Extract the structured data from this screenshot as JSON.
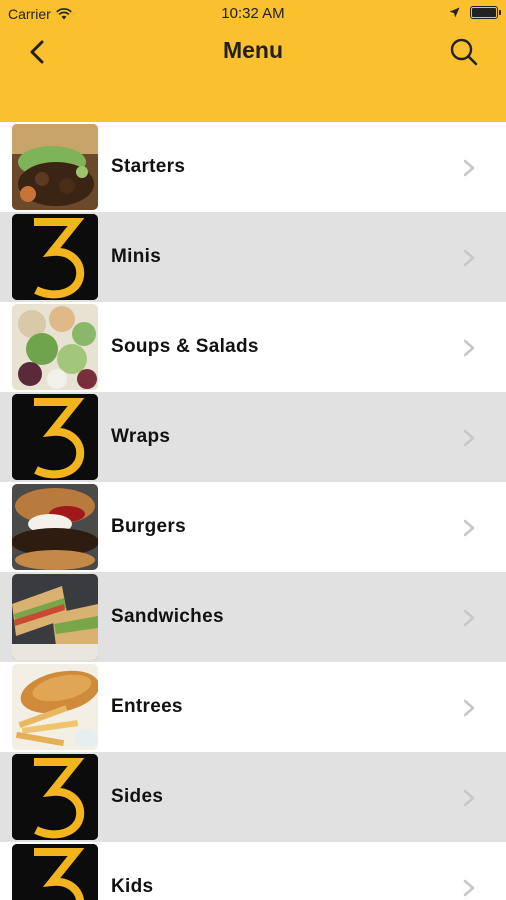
{
  "status_bar": {
    "carrier": "Carrier",
    "time": "10:32 AM"
  },
  "nav": {
    "title": "Menu",
    "back_icon": "chevron-left-icon",
    "search_icon": "search-icon"
  },
  "colors": {
    "header": "#FBC02D",
    "alt_row": "#E1E1E1",
    "logo_yellow": "#F2B51E",
    "chevron": "#C7C7C7"
  },
  "menu_items": [
    {
      "label": "Starters",
      "thumb": "photo"
    },
    {
      "label": "Minis",
      "thumb": "logo-3"
    },
    {
      "label": "Soups & Salads",
      "thumb": "photo"
    },
    {
      "label": "Wraps",
      "thumb": "logo-3"
    },
    {
      "label": "Burgers",
      "thumb": "photo"
    },
    {
      "label": "Sandwiches",
      "thumb": "photo"
    },
    {
      "label": "Entrees",
      "thumb": "photo"
    },
    {
      "label": "Sides",
      "thumb": "logo-3"
    },
    {
      "label": "Kids",
      "thumb": "logo-3"
    }
  ]
}
